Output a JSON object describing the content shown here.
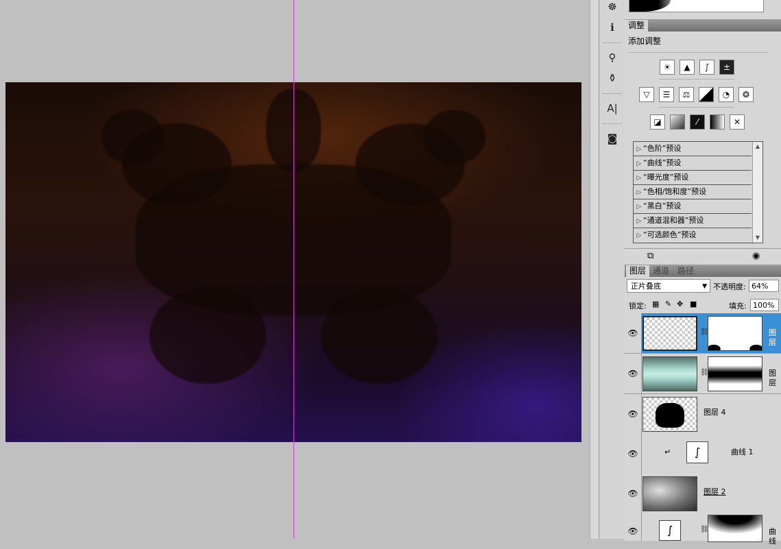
{
  "adjustments": {
    "tab_label": "调整",
    "title": "添加调整",
    "row1": [
      "brightness-contrast-icon",
      "levels-icon",
      "curves-icon",
      "exposure-icon"
    ],
    "row2": [
      "vibrance-icon",
      "hue-saturation-icon",
      "color-balance-icon",
      "black-white-icon",
      "photo-filter-icon",
      "channel-mixer-icon"
    ],
    "row3": [
      "invert-icon",
      "posterize-icon",
      "threshold-icon",
      "gradient-map-icon",
      "selective-color-icon"
    ],
    "presets": [
      "“色阶”预设",
      "“曲线”预设",
      "“曝光度”预设",
      "“色相/饱和度”预设",
      "“黑白”预设",
      "“通道混和器”预设",
      "“可选颜色”预设"
    ]
  },
  "layers_panel": {
    "tabs": [
      "图层",
      "通道",
      "路径"
    ],
    "blend_mode": "正片叠底",
    "opacity_label": "不透明度:",
    "opacity_value": "64%",
    "lock_label": "锁定:",
    "fill_label": "填充:",
    "fill_value": "100%",
    "layers": [
      {
        "name": "图层"
      },
      {
        "name": "图层"
      },
      {
        "name": "图层 4"
      },
      {
        "name": "曲线 1"
      },
      {
        "name": "图层 2"
      },
      {
        "name": "曲线"
      }
    ]
  },
  "colors": {
    "guide": "#d43fd4",
    "selection": "#3b8fd5",
    "workspace": "#c0c0c0"
  }
}
